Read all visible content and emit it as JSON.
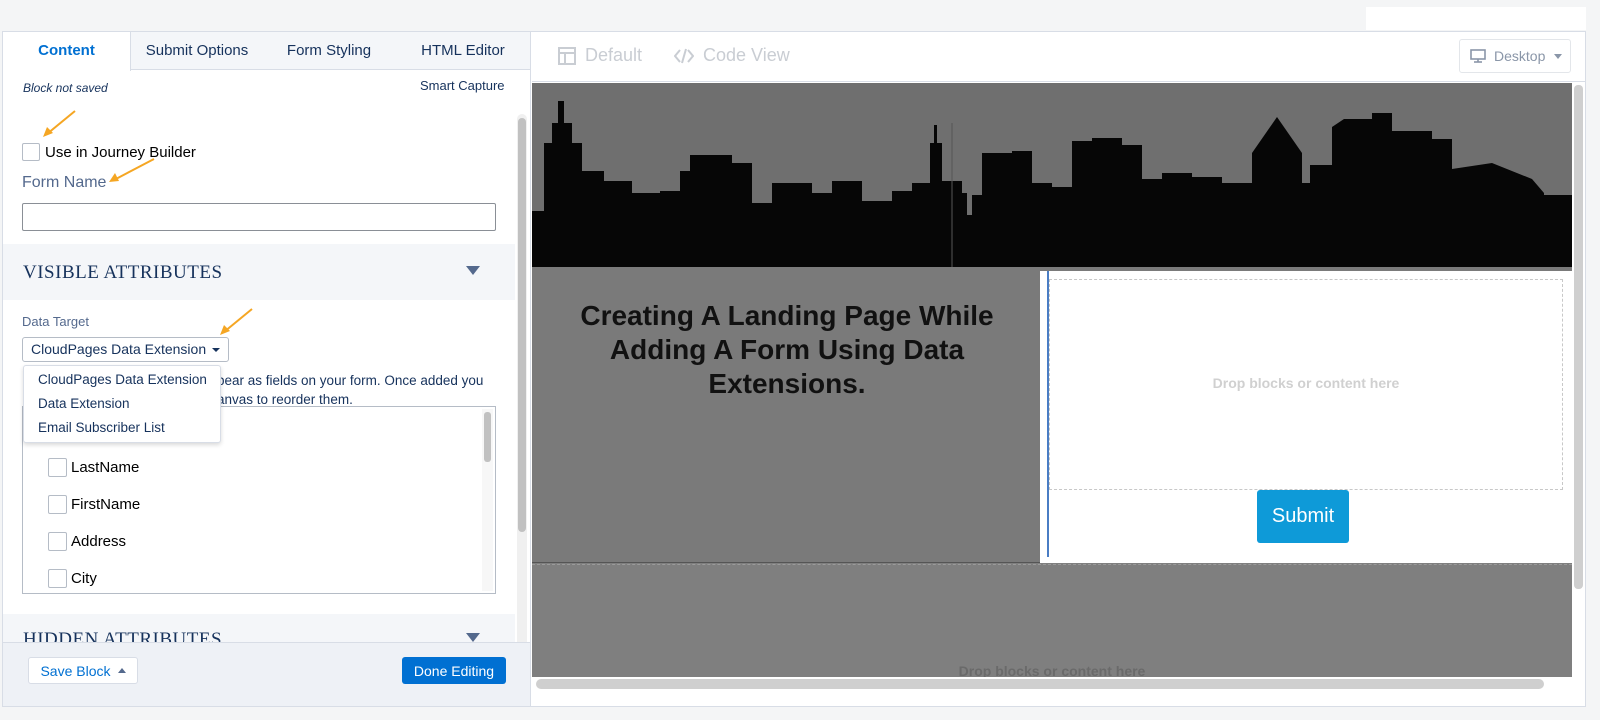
{
  "tabs": [
    {
      "label": "Content",
      "active": true
    },
    {
      "label": "Submit Options",
      "active": false
    },
    {
      "label": "Form Styling",
      "active": false
    },
    {
      "label": "HTML Editor",
      "active": false
    }
  ],
  "status": "Block not saved",
  "smart_capture": "Smart Capture",
  "journey_builder_label": "Use in Journey Builder",
  "form_name_label": "Form Name",
  "form_name_value": "",
  "visible_attributes_title": "VISIBLE ATTRIBUTES",
  "hidden_attributes_title": "HIDDEN ATTRIBUTES",
  "data_target_label": "Data Target",
  "data_target_selected": "CloudPages Data Extension",
  "data_target_options": [
    "CloudPages Data Extension",
    "Data Extension",
    "Email Subscriber List"
  ],
  "description_line1": "pear as fields on your form. Once added you",
  "description_line2": "anvas to reorder them.",
  "fields": [
    "LastName",
    "FirstName",
    "Address",
    "City"
  ],
  "footer": {
    "save_label": "Save Block",
    "done_label": "Done Editing"
  },
  "toolbar": {
    "default_label": "Default",
    "code_view_label": "Code View",
    "device_label": "Desktop"
  },
  "canvas": {
    "headline": "Creating A Landing Page While Adding A Form Using Data Extensions.",
    "drop_text": "Drop blocks or content here",
    "submit_label": "Submit",
    "bottom_drop_text": "Drop blocks or content here"
  },
  "colors": {
    "accent": "#0070d2",
    "submit": "#0e9ad8",
    "annotation_arrow": "#f5a623"
  }
}
